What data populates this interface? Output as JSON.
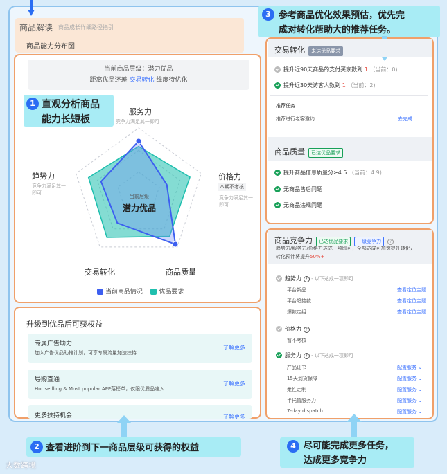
{
  "header": {
    "title": "商品解读",
    "subtitle": "商品成长详细路径指引",
    "distribution_label": "商品能力分布图"
  },
  "tier": {
    "line1_prefix": "当前商品层级：",
    "line1_value": "潜力优品",
    "line2_prefix": "距离优品还差",
    "line2_link": "交易转化",
    "line2_suffix": "维度待优化"
  },
  "callouts": {
    "c1_num": "1",
    "c1_line1": "直观分析商品",
    "c1_line2": "能力长短板",
    "c2_num": "2",
    "c2_text": "查看进阶到下一商品层级可获得的权益",
    "c3_num": "3",
    "c3_line1": "参考商品优化效果预估，优先完",
    "c3_line2": "成对转化帮助大的推荐任务。",
    "c4_num": "4",
    "c4_line1": "尽可能完成更多任务，",
    "c4_line2": "达成更多竞争力"
  },
  "radar": {
    "axes": [
      {
        "name": "服务力",
        "sub": "竞争力满足其一即可"
      },
      {
        "name": "价格力",
        "sub": "本期不考核",
        "sub2": "竞争力满足其一即可"
      },
      {
        "name": "商品质量",
        "sub": ""
      },
      {
        "name": "交易转化",
        "sub": ""
      },
      {
        "name": "趋势力",
        "sub": "竞争力满足其一即可"
      }
    ],
    "center_label": "当前层级",
    "center_value": "潜力优品",
    "legend_current": "当前商品情况",
    "legend_required": "优品要求",
    "colors": {
      "current": "#3d5ff0",
      "required": "#1fbfae"
    },
    "current_values": [
      0.8,
      0.45,
      0.95,
      0.55,
      0.6
    ],
    "required_values": [
      0.72,
      0.82,
      0.8,
      0.82,
      0.8
    ]
  },
  "benefits": {
    "title": "升级到优品后可获权益",
    "cards": [
      {
        "title": "专属广告助力",
        "desc": "加入广告优品助推计划，可享专属流量加速扶持",
        "link": "了解更多"
      },
      {
        "title": "导购直通",
        "desc": "Hot sellling & Most popular APP落榜单，仅限优质品准入",
        "link": "了解更多"
      },
      {
        "title": "更多扶持机会",
        "desc": "",
        "link": "了解更多"
      }
    ]
  },
  "transaction": {
    "title": "交易转化",
    "tag": "未达优品要求",
    "tasks": [
      {
        "text": "提升近90天商品的支付买家数到",
        "target": "1",
        "current": "（当前：0)",
        "done": false
      },
      {
        "text": "提升近30天访客人数到",
        "target": "1",
        "current": "（当前：2)",
        "done": true
      }
    ],
    "recommend_title": "推荐任务",
    "recommend_item": "推荐进行老客邀约",
    "recommend_link": "去完成"
  },
  "quality": {
    "title": "商品质量",
    "tag": "已达优品要求",
    "tasks": [
      {
        "text": "提升商品信息质量分≥4.5",
        "current": "（当前：4.9)",
        "done": true
      },
      {
        "text": "无商品售后问题",
        "current": "",
        "done": true
      },
      {
        "text": "无商品违规问题",
        "current": "",
        "done": true
      }
    ]
  },
  "competitiveness": {
    "title": "商品竞争力",
    "tag": "已达优品要求",
    "tag2": "一级竞争力",
    "desc_line1": "趋势力/服务力/价格力达成一项即可，全部达成可加速提升转化，",
    "desc_line2_prefix": "转化预计将提升",
    "desc_line2_value": "50%+",
    "trend": {
      "title": "趋势力",
      "note": "- 以下达成一项即可",
      "rows": [
        {
          "label": "平台新品",
          "link": "查看定位主题"
        },
        {
          "label": "平台趋势款",
          "link": "查看定位主题"
        },
        {
          "label": "爆款定组",
          "link": "查看定位主题"
        }
      ]
    },
    "price": {
      "title": "价格力",
      "note": "暂不考核"
    },
    "service": {
      "title": "服务力",
      "note": "- 以下达成一项即可",
      "rows": [
        {
          "label": "产品证书",
          "link": "配置服务"
        },
        {
          "label": "15天到货保障",
          "link": "配置服务"
        },
        {
          "label": "柔性定制",
          "link": "配置服务"
        },
        {
          "label": "半托管服务力",
          "link": "配置服务"
        },
        {
          "label": "7-day dispatch",
          "link": "配置服务"
        }
      ]
    }
  },
  "watermark": "大数跨境"
}
